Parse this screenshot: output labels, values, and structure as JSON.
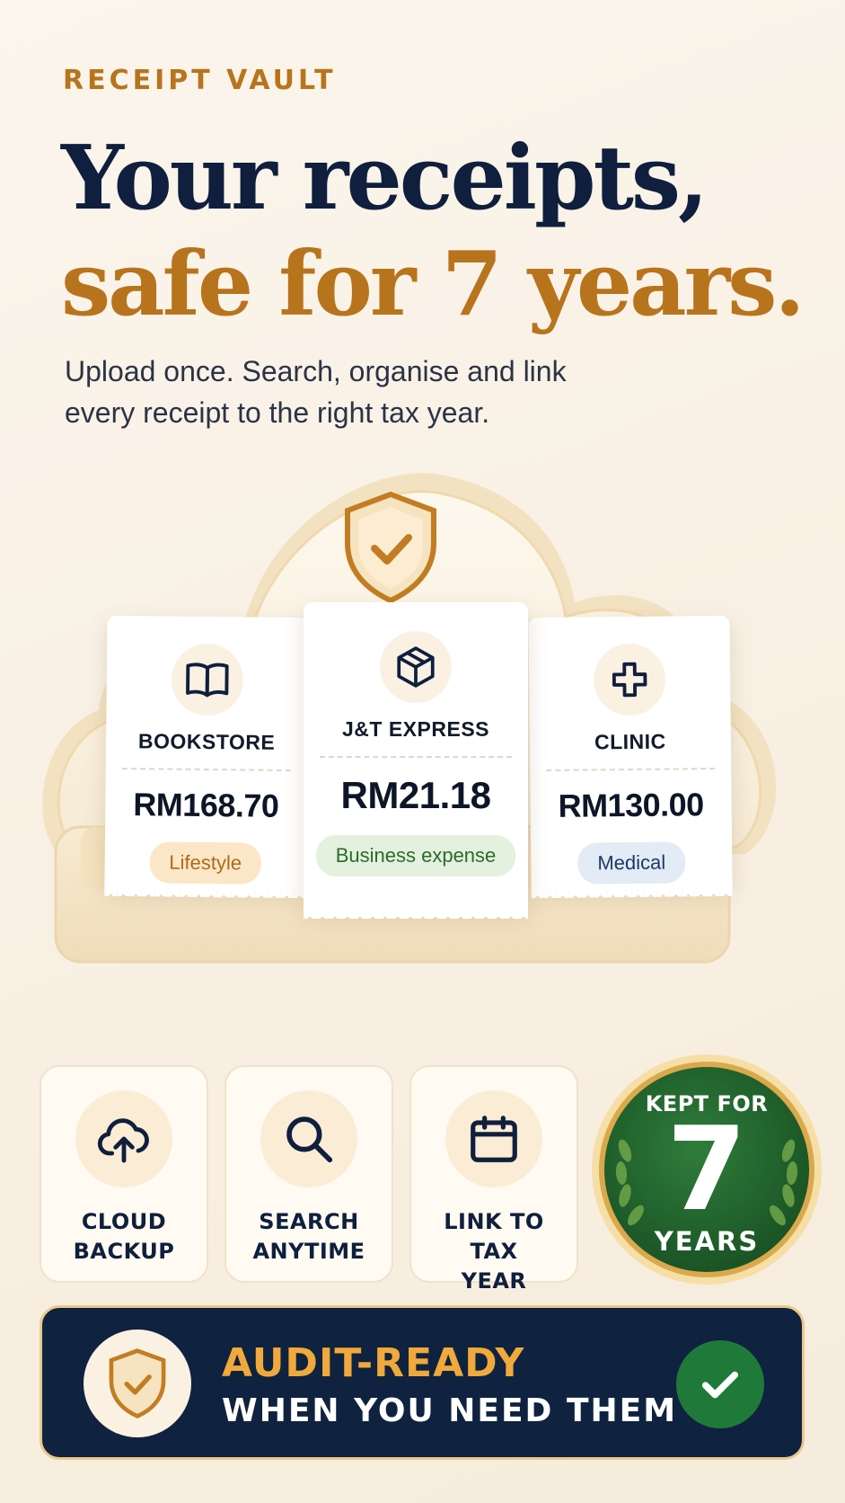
{
  "header": {
    "eyebrow": "RECEIPT VAULT",
    "title_line1": "Your receipts,",
    "title_line2": "safe for 7 years.",
    "subtitle": "Upload once. Search, organise and link every receipt to the right tax year."
  },
  "colors": {
    "navy": "#0f1f3d",
    "gold": "#b8741d",
    "green": "#1f6b2e",
    "cream": "#fbf5ec"
  },
  "receipts": [
    {
      "merchant": "BOOKSTORE",
      "amount": "RM168.70",
      "category": "Lifestyle",
      "icon": "book-icon",
      "tag_color": "#fbe6c8",
      "tag_text_color": "#b06a16"
    },
    {
      "merchant": "J&T EXPRESS",
      "amount": "RM21.18",
      "category": "Business expense",
      "icon": "package-icon",
      "tag_color": "#e3f1de",
      "tag_text_color": "#2a6b2a"
    },
    {
      "merchant": "CLINIC",
      "amount": "RM130.00",
      "category": "Medical",
      "icon": "medical-cross-icon",
      "tag_color": "#e2ebf6",
      "tag_text_color": "#1d3767"
    }
  ],
  "features": [
    {
      "label": "CLOUD BACKUP",
      "icon": "cloud-upload-icon"
    },
    {
      "label": "SEARCH ANYTIME",
      "icon": "search-icon"
    },
    {
      "label": "LINK TO TAX YEAR",
      "icon": "calendar-icon"
    }
  ],
  "seal": {
    "top": "KEPT FOR",
    "number": "7",
    "bottom": "YEARS"
  },
  "banner": {
    "line1": "AUDIT-READY",
    "line2": "WHEN YOU NEED THEM",
    "icon": "shield-check-icon",
    "check_icon": "check-icon"
  }
}
